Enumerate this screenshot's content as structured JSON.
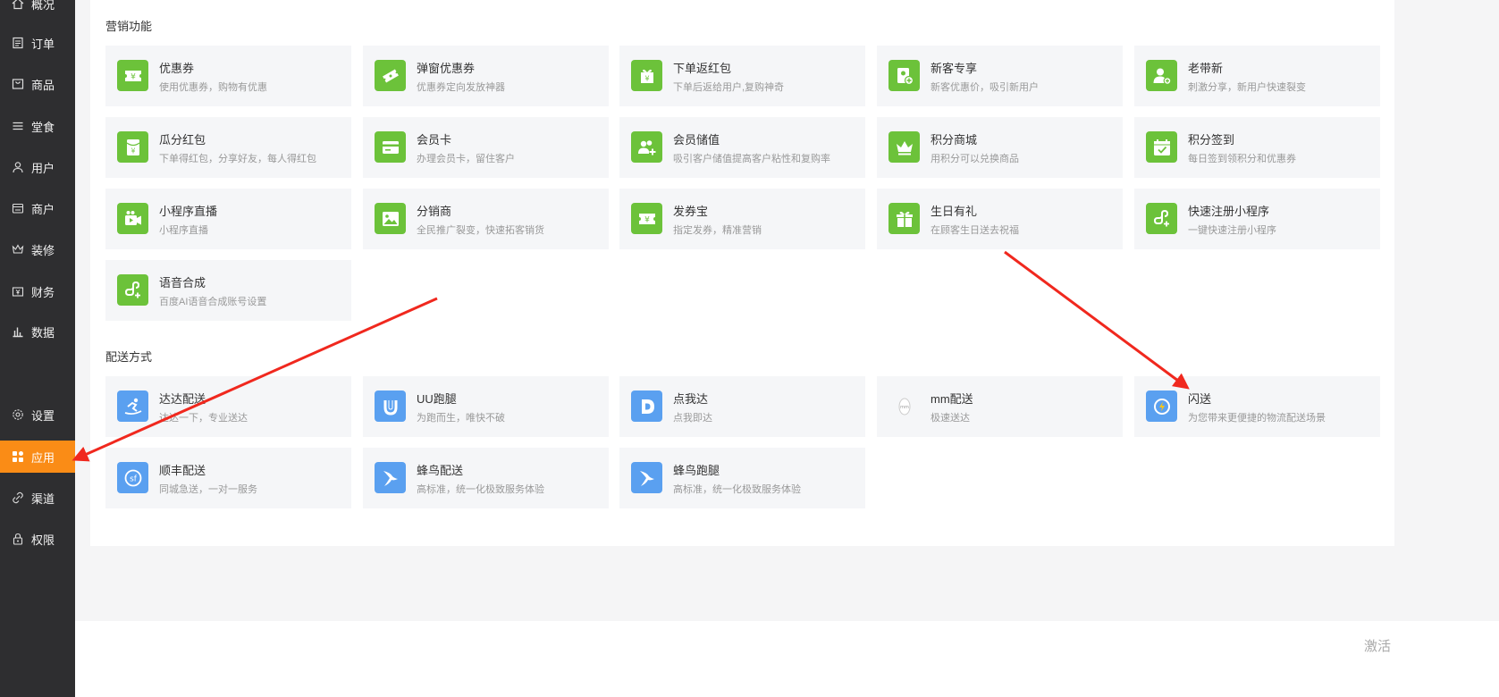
{
  "sidebar": {
    "items": [
      {
        "label": "概况",
        "icon": "home-icon"
      },
      {
        "label": "订单",
        "icon": "order-icon"
      },
      {
        "label": "商品",
        "icon": "goods-icon"
      },
      {
        "label": "堂食",
        "icon": "menu-icon"
      },
      {
        "label": "用户",
        "icon": "user-icon"
      },
      {
        "label": "商户",
        "icon": "store-icon"
      },
      {
        "label": "装修",
        "icon": "crown-icon"
      },
      {
        "label": "财务",
        "icon": "wallet-icon"
      },
      {
        "label": "数据",
        "icon": "chart-icon"
      },
      {
        "label": "设置",
        "icon": "gear-icon"
      },
      {
        "label": "应用",
        "icon": "apps-icon",
        "active": true
      },
      {
        "label": "渠道",
        "icon": "link-icon"
      },
      {
        "label": "权限",
        "icon": "lock-icon"
      }
    ]
  },
  "marketing": {
    "title": "营销功能",
    "items": [
      {
        "title": "优惠券",
        "desc": "使用优惠券，购物有优惠",
        "icon": "coupon-icon"
      },
      {
        "title": "弹窗优惠券",
        "desc": "优惠券定向发放神器",
        "icon": "popup-coupon-icon"
      },
      {
        "title": "下单返红包",
        "desc": "下单后返给用户,复购神奇",
        "icon": "red-packet-gift-icon"
      },
      {
        "title": "新客专享",
        "desc": "新客优惠价，吸引新用户",
        "icon": "new-customer-icon"
      },
      {
        "title": "老带新",
        "desc": "刺激分享，新用户快速裂变",
        "icon": "referral-icon"
      },
      {
        "title": "瓜分红包",
        "desc": "下单得红包，分享好友，每人得红包",
        "icon": "split-red-packet-icon"
      },
      {
        "title": "会员卡",
        "desc": "办理会员卡，留住客户",
        "icon": "member-card-icon"
      },
      {
        "title": "会员储值",
        "desc": "吸引客户储值提高客户粘性和复购率",
        "icon": "member-recharge-icon"
      },
      {
        "title": "积分商城",
        "desc": "用积分可以兑换商品",
        "icon": "points-mall-icon"
      },
      {
        "title": "积分签到",
        "desc": "每日签到领积分和优惠券",
        "icon": "checkin-calendar-icon"
      },
      {
        "title": "小程序直播",
        "desc": "小程序直播",
        "icon": "live-video-icon"
      },
      {
        "title": "分销商",
        "desc": "全民推广裂变，快速拓客销货",
        "icon": "distributor-image-icon"
      },
      {
        "title": "发券宝",
        "desc": "指定发券，精准营销",
        "icon": "coupon-icon"
      },
      {
        "title": "生日有礼",
        "desc": "在顾客生日送去祝福",
        "icon": "gift-icon"
      },
      {
        "title": "快速注册小程序",
        "desc": "一键快速注册小程序",
        "icon": "mini-program-icon"
      },
      {
        "title": "语音合成",
        "desc": "百度AI语音合成账号设置",
        "icon": "mini-program-icon"
      }
    ]
  },
  "delivery": {
    "title": "配送方式",
    "items": [
      {
        "title": "达达配送",
        "desc": "达达一下，专业送达",
        "icon": "dada-runner-icon"
      },
      {
        "title": "UU跑腿",
        "desc": "为跑而生，唯快不破",
        "icon": "uu-logo-icon"
      },
      {
        "title": "点我达",
        "desc": "点我即达",
        "icon": "dianwoda-logo-icon"
      },
      {
        "title": "mm配送",
        "desc": "极速送达",
        "icon": "mm-logo-icon"
      },
      {
        "title": "闪送",
        "desc": "为您带来更便捷的物流配送场景",
        "icon": "shansong-logo-icon"
      },
      {
        "title": "顺丰配送",
        "desc": "同城急送，一对一服务",
        "icon": "sf-logo-icon"
      },
      {
        "title": "蜂鸟配送",
        "desc": "高标准，统一化极致服务体验",
        "icon": "hummingbird-icon"
      },
      {
        "title": "蜂鸟跑腿",
        "desc": "高标准，统一化极致服务体验",
        "icon": "hummingbird-icon"
      }
    ]
  },
  "watermark": "激活",
  "colors": {
    "sidebar_bg": "#2e2e30",
    "active_nav": "#fa8c16",
    "marketing_icon": "#6cc23a",
    "delivery_icon": "#5aa0f0",
    "arrow": "#f0281e"
  }
}
